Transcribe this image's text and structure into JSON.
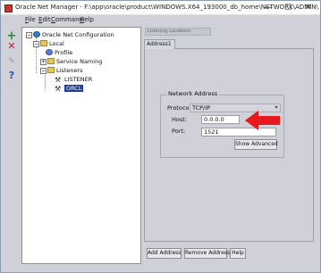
{
  "window": {
    "title": "Oracle Net Manager - F:\\app\\oracle\\product\\WINDOWS.X64_193000_db_home\\NETWORK\\ADMIN\\",
    "controls": {
      "minimize": "—",
      "maximize": "☐",
      "close": "✕"
    }
  },
  "menu": {
    "file": {
      "accel": "F",
      "rest": "ile"
    },
    "edit": {
      "accel": "E",
      "rest": "dit"
    },
    "command": {
      "accel": "C",
      "rest": "ommand"
    },
    "help": {
      "accel": "H",
      "rest": "elp"
    }
  },
  "toolbar": {
    "add": "+",
    "remove": "✕",
    "rename": "✎",
    "help": "?"
  },
  "tree": {
    "root": "Oracle Net Configuration",
    "local": "Local",
    "profile": "Profile",
    "service_naming": "Service Naming",
    "listeners": "Listeners",
    "listener": "LISTENER",
    "orcl": "ORCL"
  },
  "listening_combo": "Listening Locations",
  "tabs": {
    "address1": "Address1"
  },
  "network_address": {
    "group_label": "Network Address",
    "protocol_label": "Protocol:",
    "protocol_value": "TCP/IP",
    "host_label": "Host:",
    "host_value": "0.0.0.0",
    "port_label": "Port:",
    "port_value": "1521",
    "show_advanced": "Show Advanced"
  },
  "buttons": {
    "add_address": "Add Address",
    "remove_address": "Remove Address",
    "help": "Help"
  },
  "colors": {
    "annotation_arrow": "#e8191c",
    "selection": "#1f3f9a",
    "add_icon": "#1e8c2a",
    "remove_icon": "#d01818"
  }
}
